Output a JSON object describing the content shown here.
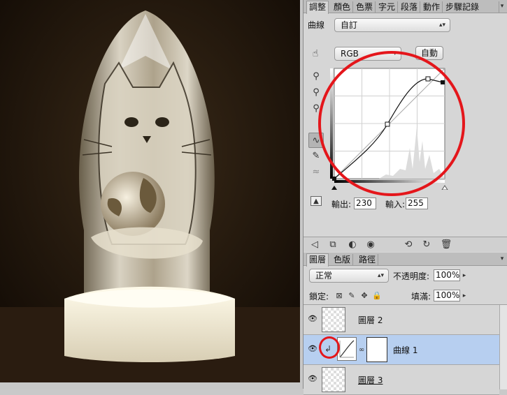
{
  "panel_tabs": [
    "調整",
    "顏色",
    "色票",
    "字元",
    "段落",
    "動作",
    "步驟記錄"
  ],
  "adjust": {
    "title": "曲線",
    "preset": "自訂",
    "channel": "RGB",
    "auto_label": "自動",
    "output_label": "輸出:",
    "output_value": "230",
    "input_label": "輸入:",
    "input_value": "255"
  },
  "layers_tabs": [
    "圖層",
    "色版",
    "路徑"
  ],
  "layers": {
    "blend_mode": "正常",
    "opacity_label": "不透明度:",
    "opacity_value": "100%",
    "lock_label": "鎖定:",
    "fill_label": "填滿:",
    "fill_value": "100%",
    "items": [
      {
        "name": "圖層 2",
        "selected": false
      },
      {
        "name": "曲線 1",
        "selected": true
      },
      {
        "name": "圖層 3",
        "selected": false
      }
    ]
  },
  "icons": [
    "hand-target-icon",
    "eyedropper-black-icon",
    "eyedropper-gray-icon",
    "eyedropper-white-icon",
    "curve-tool-icon",
    "pencil-tool-icon",
    "smooth-icon",
    "clipping-warning-icon",
    "back-arrow-icon",
    "expand-icon",
    "mask-icon",
    "visibility-icon",
    "clip-icon",
    "reset-icon",
    "trash-icon"
  ],
  "colors": {
    "highlight_circle": "#e4161b",
    "selected_layer": "#b7cff0"
  }
}
